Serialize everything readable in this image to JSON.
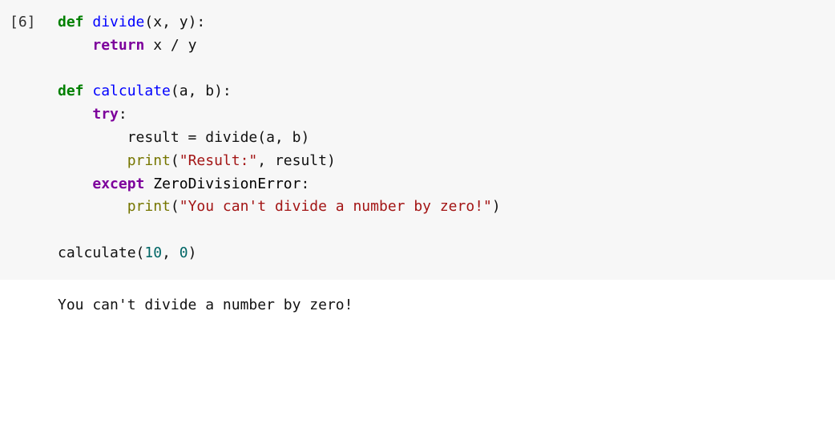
{
  "cell": {
    "prompt": "[6]",
    "code": {
      "l1": {
        "def": "def",
        "fn": "divide",
        "params": "(x, y):"
      },
      "l2": {
        "ret": "return",
        "rest": " x / y"
      },
      "l3": "",
      "l4": {
        "def": "def",
        "fn": "calculate",
        "params": "(a, b):"
      },
      "l5": {
        "try": "try",
        "colon": ":"
      },
      "l6": {
        "text": "result = divide(a, b)"
      },
      "l7": {
        "print": "print",
        "open": "(",
        "str": "\"Result:\"",
        "rest": ", result)"
      },
      "l8": {
        "exc": "except",
        "err": " ZeroDivisionError",
        "colon": ":"
      },
      "l9": {
        "print": "print",
        "open": "(",
        "str": "\"You can't divide a number by zero!\"",
        "close": ")"
      },
      "l10": "",
      "l11": {
        "call": "calculate(",
        "n1": "10",
        "comma": ", ",
        "n2": "0",
        "close": ")"
      }
    },
    "output": "You can't divide a number by zero!"
  }
}
